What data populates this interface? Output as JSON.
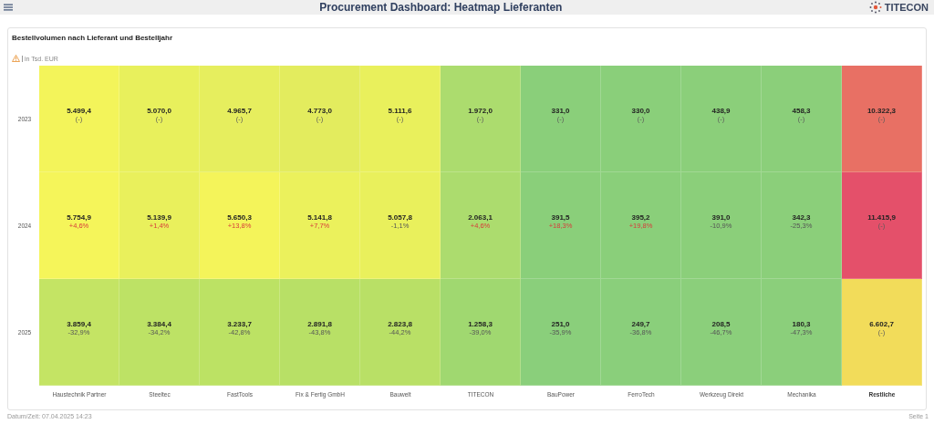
{
  "header": {
    "title": "Procurement Dashboard: Heatmap Lieferanten",
    "logo": "TITECON"
  },
  "card": {
    "title": "Bestellvolumen nach Lieferant und Bestelljahr",
    "unit_note": "in Tsd. EUR"
  },
  "heatmap": {
    "rows": [
      {
        "year": "2023",
        "cells": [
          {
            "value": "5.499,4",
            "delta": "(-)",
            "kind": "none",
            "color": "#f3f45a"
          },
          {
            "value": "5.070,0",
            "delta": "(-)",
            "kind": "none",
            "color": "#e8f05c"
          },
          {
            "value": "4.965,7",
            "delta": "(-)",
            "kind": "none",
            "color": "#e6ee5e"
          },
          {
            "value": "4.773,0",
            "delta": "(-)",
            "kind": "none",
            "color": "#e3ec5e"
          },
          {
            "value": "5.111,6",
            "delta": "(-)",
            "kind": "none",
            "color": "#e9f05c"
          },
          {
            "value": "1.972,0",
            "delta": "(-)",
            "kind": "none",
            "color": "#acdc6e"
          },
          {
            "value": "331,0",
            "delta": "(-)",
            "kind": "none",
            "color": "#8acf7a"
          },
          {
            "value": "330,0",
            "delta": "(-)",
            "kind": "none",
            "color": "#8acf7a"
          },
          {
            "value": "438,9",
            "delta": "(-)",
            "kind": "none",
            "color": "#8bcf7a"
          },
          {
            "value": "458,3",
            "delta": "(-)",
            "kind": "none",
            "color": "#8bcf7a"
          },
          {
            "value": "10.322,3",
            "delta": "(-)",
            "kind": "none",
            "color": "#e87064"
          }
        ]
      },
      {
        "year": "2024",
        "cells": [
          {
            "value": "5.754,9",
            "delta": "+4,6%",
            "kind": "up",
            "color": "#f5f55a"
          },
          {
            "value": "5.139,9",
            "delta": "+1,4%",
            "kind": "up",
            "color": "#e9f05c"
          },
          {
            "value": "5.650,3",
            "delta": "+13,8%",
            "kind": "up",
            "color": "#f4f45a"
          },
          {
            "value": "5.141,8",
            "delta": "+7,7%",
            "kind": "up",
            "color": "#ebf15c"
          },
          {
            "value": "5.057,8",
            "delta": "-1,1%",
            "kind": "down",
            "color": "#e9f05c"
          },
          {
            "value": "2.063,1",
            "delta": "+4,6%",
            "kind": "up",
            "color": "#acdc6e"
          },
          {
            "value": "391,5",
            "delta": "+18,3%",
            "kind": "up",
            "color": "#8acf7a"
          },
          {
            "value": "395,2",
            "delta": "+19,8%",
            "kind": "up",
            "color": "#8acf7a"
          },
          {
            "value": "391,0",
            "delta": "-10,9%",
            "kind": "down",
            "color": "#8bcf7a"
          },
          {
            "value": "342,3",
            "delta": "-25,3%",
            "kind": "down",
            "color": "#8bcf7a"
          },
          {
            "value": "11.415,9",
            "delta": "(-)",
            "kind": "none",
            "color": "#e4506a"
          }
        ]
      },
      {
        "year": "2025",
        "cells": [
          {
            "value": "3.859,4",
            "delta": "-32,9%",
            "kind": "down",
            "color": "#c4e464"
          },
          {
            "value": "3.384,4",
            "delta": "-34,2%",
            "kind": "down",
            "color": "#bde265"
          },
          {
            "value": "3.233,7",
            "delta": "-42,8%",
            "kind": "down",
            "color": "#bce264"
          },
          {
            "value": "2.891,8",
            "delta": "-43,8%",
            "kind": "down",
            "color": "#b8e066"
          },
          {
            "value": "2.823,8",
            "delta": "-44,2%",
            "kind": "down",
            "color": "#b9e066"
          },
          {
            "value": "1.258,3",
            "delta": "-39,0%",
            "kind": "down",
            "color": "#a0d870"
          },
          {
            "value": "251,0",
            "delta": "-35,9%",
            "kind": "down",
            "color": "#8acf7b"
          },
          {
            "value": "249,7",
            "delta": "-36,8%",
            "kind": "down",
            "color": "#8acf7b"
          },
          {
            "value": "208,5",
            "delta": "-46,7%",
            "kind": "down",
            "color": "#8bcf7b"
          },
          {
            "value": "180,3",
            "delta": "-47,3%",
            "kind": "down",
            "color": "#8bcf7b"
          },
          {
            "value": "6.602,7",
            "delta": "(-)",
            "kind": "none",
            "color": "#f2dc5a"
          }
        ]
      }
    ],
    "supplier_labels": [
      {
        "label": "Haustechnik Partner",
        "emphasized": false
      },
      {
        "label": "Steeltec",
        "emphasized": false
      },
      {
        "label": "FastTools",
        "emphasized": false
      },
      {
        "label": "Fix & Fertig GmbH",
        "emphasized": false
      },
      {
        "label": "Bauwelt",
        "emphasized": false
      },
      {
        "label": "TITECON",
        "emphasized": false
      },
      {
        "label": "BauPower",
        "emphasized": false
      },
      {
        "label": "FerroTech",
        "emphasized": false
      },
      {
        "label": "Werkzeug Direkt",
        "emphasized": false
      },
      {
        "label": "Mechanika",
        "emphasized": false
      },
      {
        "label": "Restliche",
        "emphasized": true
      }
    ]
  },
  "footer": {
    "timestamp": "Datum/Zeit: 07.04.2025 14:23",
    "page": "Seite 1"
  }
}
